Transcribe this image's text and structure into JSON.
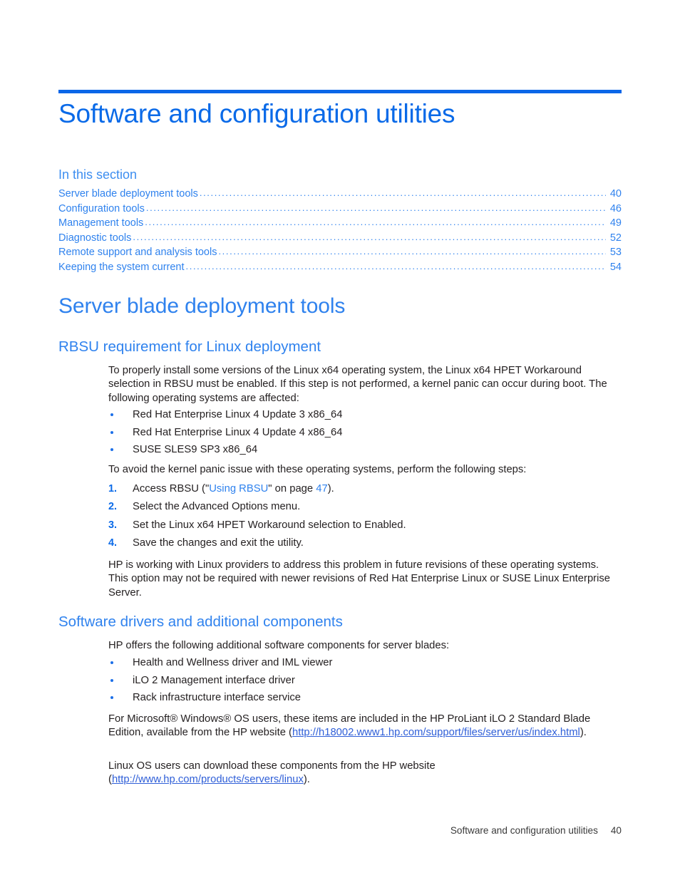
{
  "document": {
    "chapter_title": "Software and configuration utilities",
    "accent_color": "#0a6ae8",
    "link_color": "#2f82ee",
    "body_color": "#231f20"
  },
  "toc": {
    "heading": "In this section",
    "entries": [
      {
        "label": "Server blade deployment tools",
        "page": "40"
      },
      {
        "label": "Configuration tools",
        "page": "46"
      },
      {
        "label": "Management tools",
        "page": "49"
      },
      {
        "label": "Diagnostic tools",
        "page": "52"
      },
      {
        "label": "Remote support and analysis tools",
        "page": "53"
      },
      {
        "label": "Keeping the system current",
        "page": "54"
      }
    ]
  },
  "sections": {
    "server_blade_deployment_tools": {
      "heading": "Server blade deployment tools"
    },
    "rbsu": {
      "heading": "RBSU requirement for Linux deployment",
      "intro": "To properly install some versions of the Linux x64 operating system, the Linux x64 HPET Workaround selection in RBSU must be enabled. If this step is not performed, a kernel panic can occur during boot. The following operating systems are affected:",
      "affected_os": [
        "Red Hat Enterprise Linux 4 Update 3 x86_64",
        "Red Hat Enterprise Linux 4 Update 4 x86_64",
        "SUSE SLES9 SP3 x86_64"
      ],
      "steps_intro": "To avoid the kernel panic issue with these operating systems, perform the following steps:",
      "steps": [
        {
          "number": "1.",
          "prefix": "Access RBSU (\"",
          "xref": "Using RBSU",
          "middle": "\" on page ",
          "page": "47",
          "suffix": ")."
        },
        {
          "number": "2.",
          "text": "Select the Advanced Options menu."
        },
        {
          "number": "3.",
          "text": "Set the Linux x64 HPET Workaround selection to Enabled."
        },
        {
          "number": "4.",
          "text": "Save the changes and exit the utility."
        }
      ],
      "closing": "HP is working with Linux providers to address this problem in future revisions of these operating systems. This option may not be required with newer revisions of Red Hat Enterprise Linux or SUSE Linux Enterprise Server."
    },
    "software_drivers": {
      "heading": "Software drivers and additional components",
      "intro": "HP offers the following additional software components for server blades:",
      "components": [
        "Health and Wellness driver and IML viewer",
        "iLO 2 Management interface driver",
        "Rack infrastructure interface service"
      ],
      "windows_paragraph_before": "For Microsoft® Windows® OS users, these items are included in the HP ProLiant iLO 2 Standard Blade Edition, available from the HP website (",
      "windows_link": "http://h18002.www1.hp.com/support/files/server/us/index.html",
      "windows_paragraph_after": ").",
      "linux_paragraph_before": "Linux OS users can download these components from the HP website (",
      "linux_link": "http://www.hp.com/products/servers/linux",
      "linux_paragraph_after": ")."
    }
  },
  "footer": {
    "title": "Software and configuration utilities",
    "page_number": "40"
  }
}
